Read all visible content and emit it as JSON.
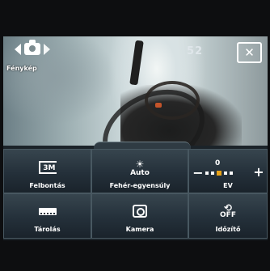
{
  "viewfinder": {
    "mode_label": "Fénykép",
    "shots_remaining": "52",
    "close_symbol": "⊠"
  },
  "icons": {
    "prev": "chevron-left-icon",
    "mode": "camera-icon",
    "next": "chevron-right-icon",
    "close": "close-icon"
  },
  "controls": {
    "resolution": {
      "label": "Felbontás",
      "icon_text": "3M"
    },
    "white_balance": {
      "label": "Fehér-egyensúly",
      "icon_text": "Auto"
    },
    "ev": {
      "label": "EV",
      "value": "0",
      "minus": "−",
      "plus": "+"
    },
    "storage": {
      "label": "Tárolás"
    },
    "camera": {
      "label": "Kamera"
    },
    "timer": {
      "label": "Időzítő",
      "icon_text": "OFF"
    }
  },
  "colors": {
    "panel": "#1b2329",
    "ev_indicator": "#e8a217"
  }
}
